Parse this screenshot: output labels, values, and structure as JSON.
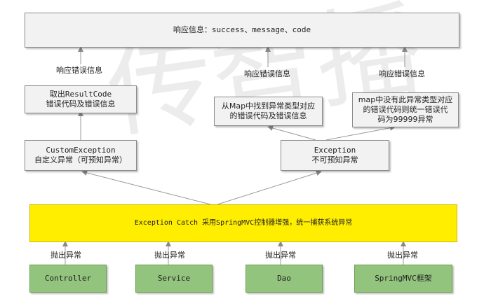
{
  "watermark": "传智播",
  "top_box": "响应信息：success、message、code",
  "resultcode_box": {
    "line1": "取出ResultCode",
    "line2": "错误代码及错误信息"
  },
  "map_found_box": {
    "line1": "从Map中找到异常类型对应",
    "line2": "的错误代码及错误信息"
  },
  "map_missing_box": {
    "line1": "map中没有此异常类型对应",
    "line2": "的错误代码则统一错误代",
    "line3": "码为99999异常"
  },
  "custom_exception_box": {
    "line1": "CustomException",
    "line2": "自定义异常（可预知异常）"
  },
  "exception_box": {
    "line1": "Exception",
    "line2": "不可预知异常"
  },
  "catch_box": "Exception Catch 采用SpringMVC控制器增强，统一捕获系统异常",
  "labels": {
    "response_error_1": "响应错误信息",
    "response_error_2": "响应错误信息",
    "response_error_3": "响应错误信息",
    "throw_1": "抛出异常",
    "throw_2": "抛出异常",
    "throw_3": "抛出异常",
    "throw_4": "抛出异常"
  },
  "sources": [
    "Controller",
    "Service",
    "Dao",
    "SpringMVC框架"
  ]
}
